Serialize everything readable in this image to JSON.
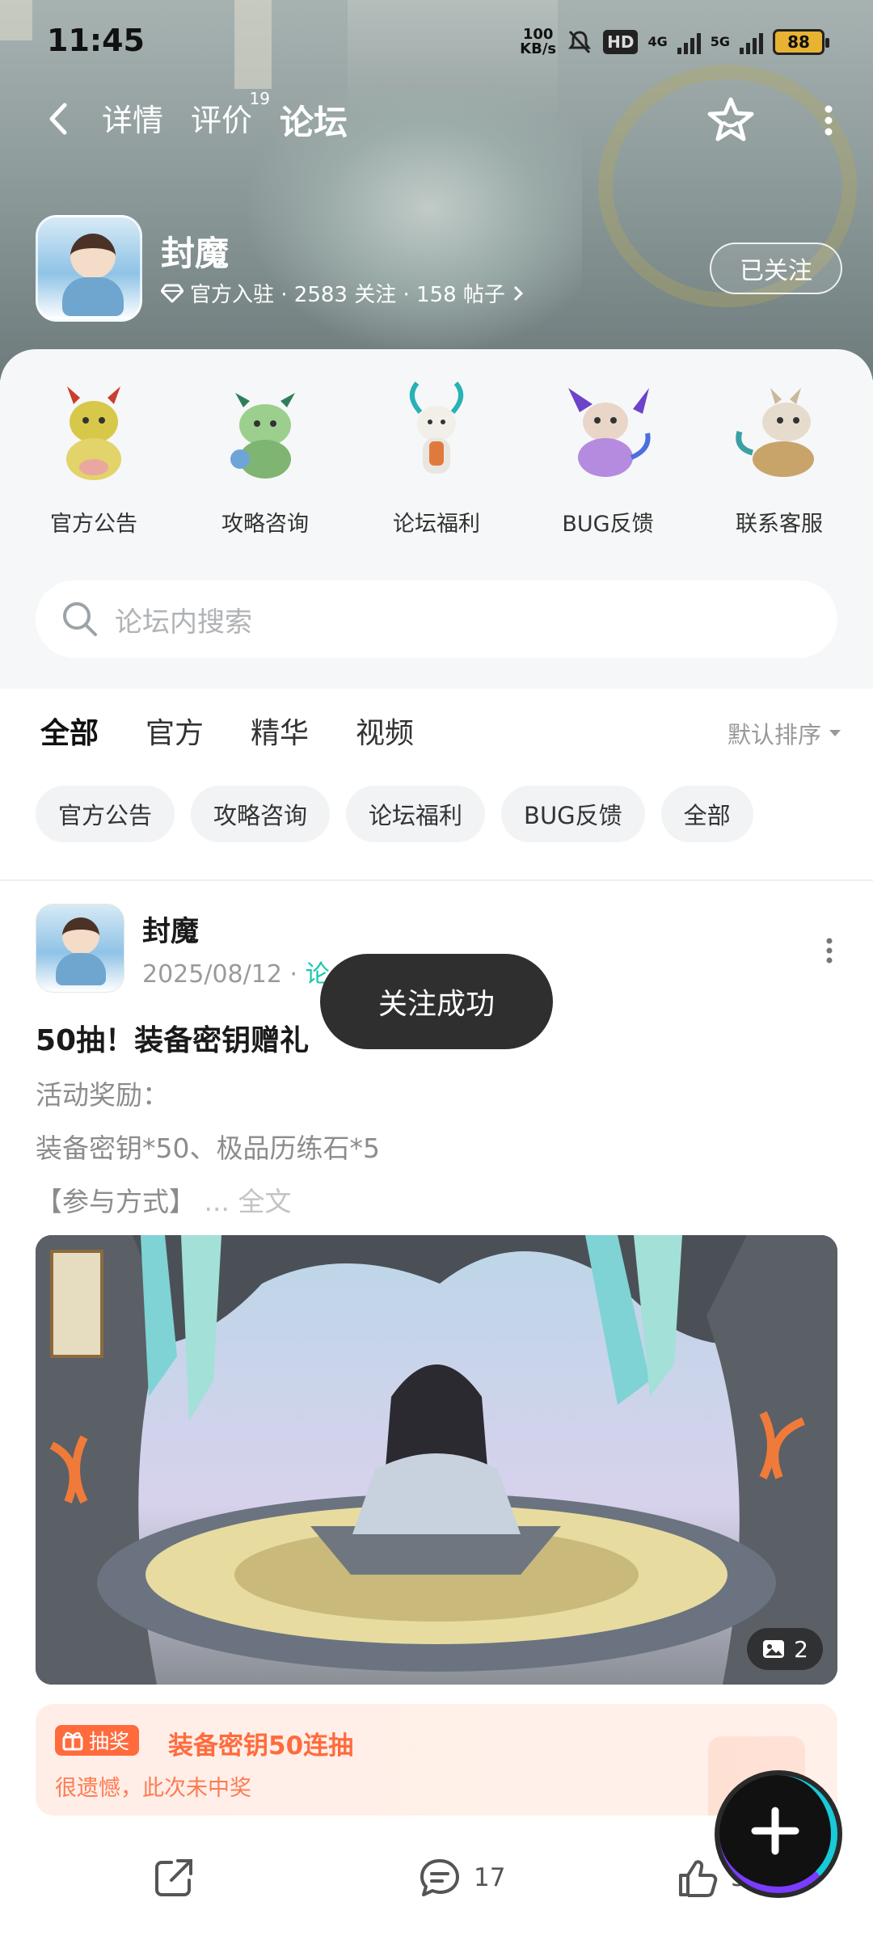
{
  "status_bar": {
    "time": "11:45",
    "speed_value": "100",
    "speed_unit": "KB/s",
    "hd_label": "HD",
    "net1": "4G",
    "net2": "5G",
    "battery": "88"
  },
  "nav": {
    "tabs": [
      {
        "label": "详情"
      },
      {
        "label": "评价",
        "badge": "19"
      },
      {
        "label": "论坛",
        "active": true
      }
    ]
  },
  "game": {
    "name": "封魔",
    "meta": "官方入驻 · 2583 关注 · 158 帖子",
    "follow_label": "已关注"
  },
  "categories": [
    {
      "label": "官方公告",
      "color": "#d8c84a"
    },
    {
      "label": "攻略咨询",
      "color": "#6bb27a"
    },
    {
      "label": "论坛福利",
      "color": "#e9e6e2"
    },
    {
      "label": "BUG反馈",
      "color": "#b58be0"
    },
    {
      "label": "联系客服",
      "color": "#c9a46a"
    }
  ],
  "search": {
    "placeholder": "论坛内搜索"
  },
  "filters": {
    "tabs": [
      "全部",
      "官方",
      "精华",
      "视频"
    ],
    "sort_label": "默认排序",
    "chips": [
      "官方公告",
      "攻略咨询",
      "论坛福利",
      "BUG反馈",
      "全部"
    ]
  },
  "post": {
    "author": "封魔",
    "date": "2025/08/12",
    "date_sep": "·",
    "tag_partial": "论",
    "title": "50抽！装备密钥赠礼",
    "body_line1": "活动奖励：",
    "body_line2": "装备密钥*50、极品历练石*5",
    "body_line3": "【参与方式】",
    "more_link": "... 全文",
    "image_count": "2",
    "lottery": {
      "badge": "抽奖",
      "title": "装备密钥50连抽",
      "result": "很遗憾，此次未中奖"
    },
    "comments": "17",
    "likes_partial": "5"
  },
  "toast": "关注成功",
  "colors": {
    "accent": "#17d3b5",
    "lottery": "#ff6b3d"
  }
}
